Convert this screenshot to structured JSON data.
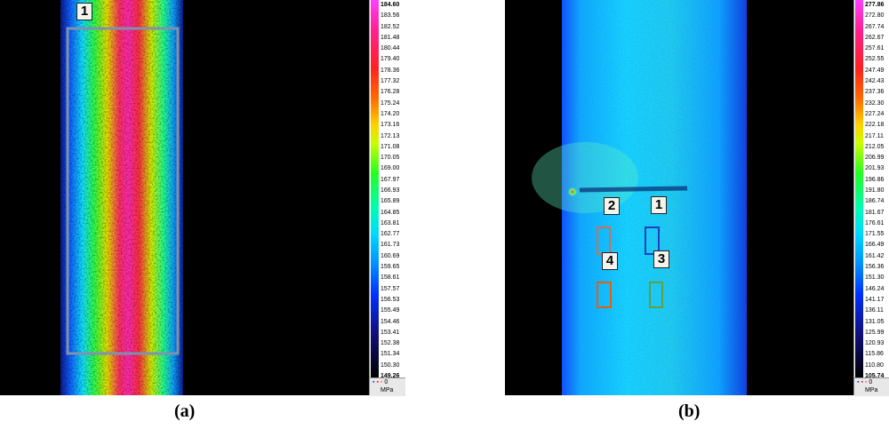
{
  "panels": [
    {
      "caption": "(a)",
      "unit": "MPa",
      "colorbar_ticks": [
        "184.60",
        "183.56",
        "182.52",
        "181.48",
        "180.44",
        "179.40",
        "178.36",
        "177.32",
        "176.28",
        "175.24",
        "174.20",
        "173.16",
        "172.13",
        "171.08",
        "170.05",
        "169.00",
        "167.97",
        "166.93",
        "165.89",
        "164.85",
        "163.81",
        "162.77",
        "161.73",
        "160.69",
        "159.65",
        "158.61",
        "157.57",
        "156.53",
        "155.49",
        "154.46",
        "153.41",
        "152.38",
        "151.34",
        "150.30",
        "149.26"
      ],
      "regions": [
        "1"
      ],
      "footer_indicator": "0"
    },
    {
      "caption": "(b)",
      "unit": "MPa",
      "colorbar_ticks": [
        "277.86",
        "272.80",
        "267.74",
        "262.67",
        "257.61",
        "252.55",
        "247.49",
        "242.43",
        "237.36",
        "232.30",
        "227.24",
        "222.18",
        "217.11",
        "212.05",
        "206.99",
        "201.93",
        "196.86",
        "191.80",
        "186.74",
        "181.67",
        "176.61",
        "171.55",
        "166.49",
        "161.42",
        "156.36",
        "151.30",
        "146.24",
        "141.17",
        "136.11",
        "131.05",
        "125.99",
        "120.93",
        "115.86",
        "110.80",
        "105.74"
      ],
      "regions": [
        "1",
        "2",
        "3",
        "4"
      ],
      "footer_indicator": "0"
    }
  ],
  "colors": {
    "region_1_b": "#2040c0",
    "region_2_b": "#d07050",
    "region_3_b": "#60a040",
    "region_4_b": "#e06010",
    "region_1_a": "#8090b0"
  }
}
